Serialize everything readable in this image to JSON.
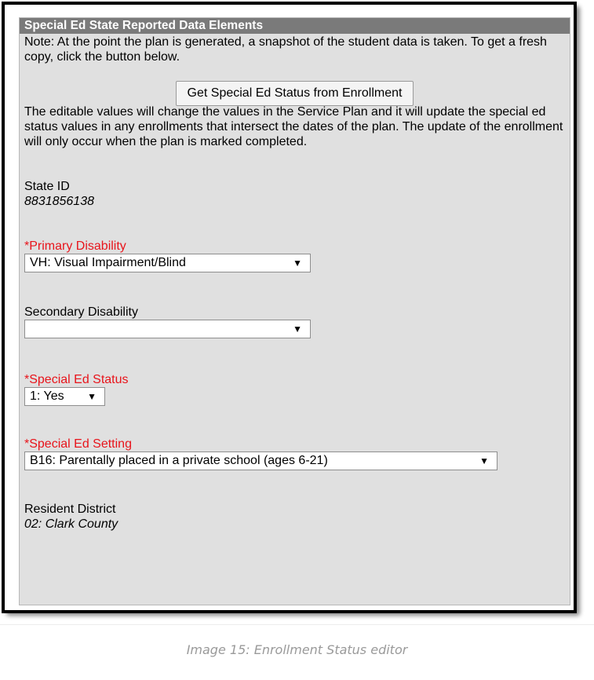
{
  "panel": {
    "header": "Special Ed State Reported Data Elements",
    "note": "Note: At the point the plan is generated, a snapshot of the student data is taken. To get a fresh copy, click the button below.",
    "button_label": "Get Special Ed Status from Enrollment",
    "help_text": "The editable values will change the values in the Service Plan and it will update the special ed status values in any enrollments that intersect the dates of the plan. The update of the enrollment will only occur when the plan is marked completed."
  },
  "fields": {
    "state_id": {
      "label": "State ID",
      "value": "8831856138"
    },
    "primary_disability": {
      "label": "*Primary Disability",
      "selected": "VH: Visual Impairment/Blind"
    },
    "secondary_disability": {
      "label": "Secondary Disability",
      "selected": ""
    },
    "special_ed_status": {
      "label": "*Special Ed Status",
      "selected": "1: Yes"
    },
    "special_ed_setting": {
      "label": "*Special Ed Setting",
      "selected": "B16: Parentally placed in a private school (ages 6-21)"
    },
    "resident_district": {
      "label": "Resident District",
      "value": "02: Clark County"
    }
  },
  "icons": {
    "dropdown": "chevron-down-icon",
    "caret_glyph": "▼"
  },
  "colors": {
    "required_label": "#e8141b",
    "header_bg": "#7a7a7a",
    "panel_bg": "#e0e0e0"
  },
  "caption": "Image 15: Enrollment Status editor"
}
